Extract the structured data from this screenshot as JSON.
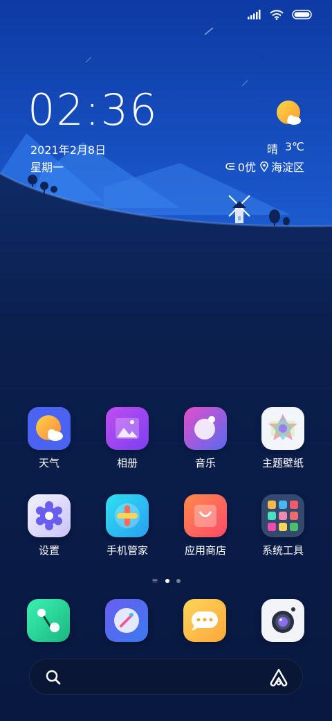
{
  "status_bar": {
    "signal_icon": "signal-bars-icon",
    "wifi_icon": "wifi-icon",
    "battery_icon": "battery-icon"
  },
  "clock_widget": {
    "time": "02:36",
    "date": "2021年2月8日",
    "weekday": "星期一"
  },
  "weather_widget": {
    "icon": "sun-cloud-icon",
    "condition": "晴",
    "temperature": "3℃",
    "aqi": "0优",
    "location": "海淀区"
  },
  "apps_row1": [
    {
      "label": "天气",
      "icon": "weather-app-icon"
    },
    {
      "label": "相册",
      "icon": "gallery-app-icon"
    },
    {
      "label": "音乐",
      "icon": "music-app-icon"
    },
    {
      "label": "主题壁纸",
      "icon": "themes-app-icon"
    }
  ],
  "apps_row2": [
    {
      "label": "设置",
      "icon": "settings-app-icon"
    },
    {
      "label": "手机管家",
      "icon": "security-app-icon"
    },
    {
      "label": "应用商店",
      "icon": "app-store-icon"
    },
    {
      "label": "系统工具",
      "icon": "system-tools-folder-icon"
    }
  ],
  "pager": {
    "menu_glyph": "≡",
    "pages": 2,
    "active_page": 1
  },
  "dock": [
    {
      "name": "phone-app-icon"
    },
    {
      "name": "browser-app-icon"
    },
    {
      "name": "messages-app-icon"
    },
    {
      "name": "camera-app-icon"
    }
  ],
  "search_bar": {
    "search_icon": "search-icon",
    "assistant_icon": "assistant-icon"
  },
  "colors": {
    "sky_top": "#0d3a9e",
    "sky_bottom": "#1a55c8",
    "ground": "#0b1f4d"
  }
}
